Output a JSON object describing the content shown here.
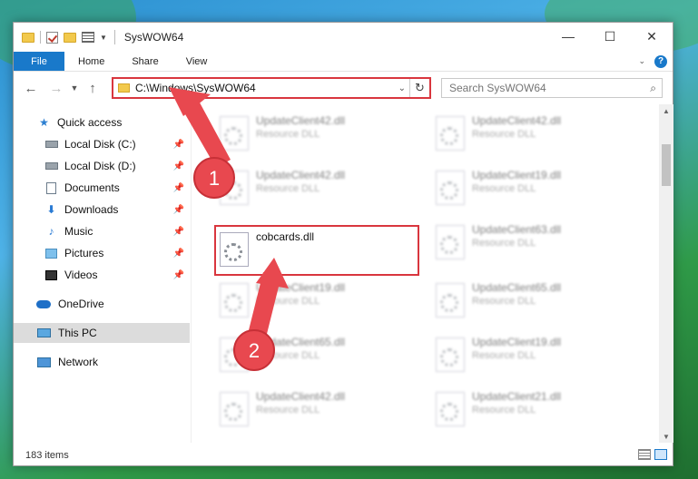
{
  "window": {
    "title": "SysWOW64",
    "controls": {
      "minimize": "—",
      "maximize": "☐",
      "close": "✕"
    }
  },
  "ribbon": {
    "tabs": [
      "File",
      "Home",
      "Share",
      "View"
    ]
  },
  "address": {
    "path": "C:\\Windows\\SysWOW64",
    "search_placeholder": "Search SysWOW64"
  },
  "sidebar": {
    "items": [
      {
        "label": "Quick access",
        "icon": "star-icon"
      },
      {
        "label": "Local Disk (C:)",
        "icon": "disk-icon",
        "pinned": true
      },
      {
        "label": "Local Disk (D:)",
        "icon": "disk-icon",
        "pinned": true
      },
      {
        "label": "Documents",
        "icon": "documents-icon",
        "pinned": true
      },
      {
        "label": "Downloads",
        "icon": "downloads-icon",
        "pinned": true
      },
      {
        "label": "Music",
        "icon": "music-icon",
        "pinned": true
      },
      {
        "label": "Pictures",
        "icon": "pictures-icon",
        "pinned": true
      },
      {
        "label": "Videos",
        "icon": "videos-icon",
        "pinned": true
      },
      {
        "label": "OneDrive",
        "icon": "onedrive-icon"
      },
      {
        "label": "This PC",
        "icon": "this-pc-icon",
        "selected": true
      },
      {
        "label": "Network",
        "icon": "network-icon"
      }
    ]
  },
  "files": [
    {
      "name": "UpdateClient42.dll",
      "type": "Resource DLL"
    },
    {
      "name": "UpdateClient42.dll",
      "type": "Resource DLL"
    },
    {
      "name": "UpdateClient42.dll",
      "type": "Resource DLL"
    },
    {
      "name": "UpdateClient19.dll",
      "type": "Resource DLL"
    },
    {
      "name": "cobcards.dll",
      "type": ""
    },
    {
      "name": "UpdateClient63.dll",
      "type": "Resource DLL"
    },
    {
      "name": "UpdateClient19.dll",
      "type": "Resource DLL"
    },
    {
      "name": "UpdateClient65.dll",
      "type": "Resource DLL"
    },
    {
      "name": "UpdateClient65.dll",
      "type": "Resource DLL"
    },
    {
      "name": "UpdateClient19.dll",
      "type": "Resource DLL"
    },
    {
      "name": "UpdateClient42.dll",
      "type": "Resource DLL"
    },
    {
      "name": "UpdateClient21.dll",
      "type": "Resource DLL"
    }
  ],
  "status": {
    "item_count": "183 items"
  },
  "annotations": {
    "step1": "1",
    "step2": "2"
  },
  "colors": {
    "accent": "#1979ca",
    "highlight": "#d9363e"
  }
}
